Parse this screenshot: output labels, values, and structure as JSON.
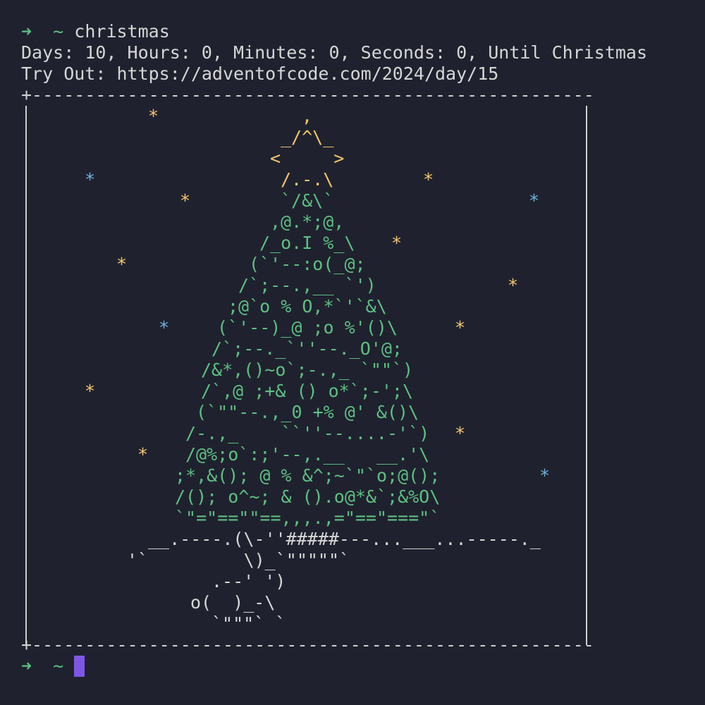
{
  "terminal": {
    "prompt_arrow": "➜",
    "prompt_dir": "~",
    "command": "christmas",
    "countdown_line": "Days: 10, Hours: 0, Minutes: 0, Seconds: 0, Until Christmas",
    "tryout_line": "Try Out: https://adventofcode.com/2024/day/15"
  },
  "colors": {
    "background": "#1f222e",
    "prompt_green": "#5fbf83",
    "star_yellow": "#f2c66d",
    "star_blue": "#6fb1d9",
    "tree_green": "#5fbf83",
    "ornament_red": "#e0735e",
    "ornament_blue": "#6fb1d9",
    "trunk_white": "#d6d6d6",
    "cursor": "#7e56e6"
  },
  "box": {
    "top_border": "+-----------------------------------------------------+",
    "bottom_border": "+-----------------------------------------------------+"
  },
  "art": {
    "tree_lines": [
      ",",
      "_/^\\_",
      "<     >",
      "/.-.\\",
      "`/&\\`",
      ",@.*;@,",
      "/_o.I %_\\",
      "(`'--:o(_@;",
      "/`;--.,__ `')",
      ";@`o % O,*`'`&\\",
      "(`'--)_@ ;o %'()\\",
      "/`;--._`''--._O'@;",
      "/&*,()~o`;-.,_ `\"\"`)",
      "/`,@ ;+& () o*`;-';\\",
      "(`\"\"--.,_0 +% @' &()\\",
      "/-.,_    ``''--....-'`)",
      "/@%;o`:;'--,.__   __.'\\",
      ";*,&(); @ % &^;~`\"`o;@();",
      "/(); o^~; & ().o@*&`;&%O\\",
      "`\"=\"==\"\"==,,,.,=\"==\"===\"`"
    ],
    "ground_line": "__.----.(\\-''#####---...___...-----._",
    "trunk_lines": [
      "'`         \\)_`\"\"\"\"\"`",
      ".--' ')",
      "o(  )_-\\",
      "`\"\"\"` `"
    ]
  },
  "stars": {
    "glyph": "*"
  }
}
